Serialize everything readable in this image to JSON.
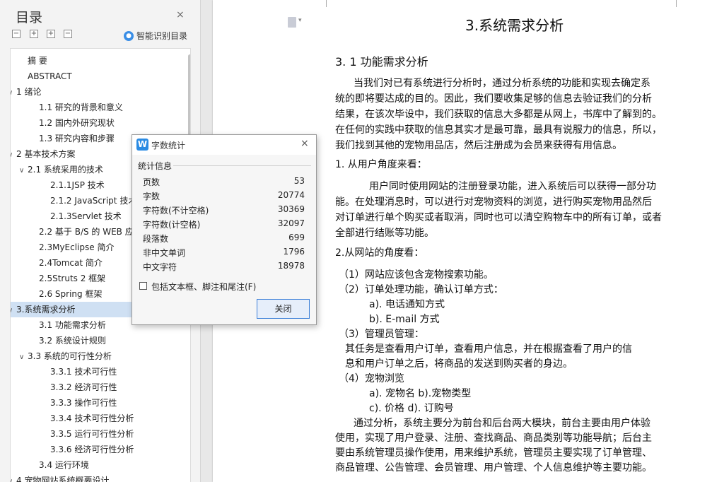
{
  "sidebar": {
    "title": "目录",
    "close_glyph": "×",
    "toolbar": {
      "collapse_all": "−",
      "expand_all": "+",
      "expand_level": "+",
      "collapse_level": "−"
    },
    "smart_toc_label": "智能识别目录",
    "items": [
      {
        "label": "摘  要",
        "chevron": ""
      },
      {
        "label": "ABSTRACT",
        "chevron": ""
      },
      {
        "label": "1 绪论",
        "chevron": "∨"
      },
      {
        "label": "1.1 研究的背景和意义",
        "chevron": ""
      },
      {
        "label": "1.2 国内外研究现状",
        "chevron": ""
      },
      {
        "label": "1.3 研究内容和步骤",
        "chevron": ""
      },
      {
        "label": "2 基本技术方案",
        "chevron": "∨"
      },
      {
        "label": "2.1 系统采用的技术",
        "chevron": "∨"
      },
      {
        "label": "2.1.1JSP 技术",
        "chevron": ""
      },
      {
        "label": "2.1.2 JavaScript 技术",
        "chevron": ""
      },
      {
        "label": "2.1.3Servlet 技术",
        "chevron": ""
      },
      {
        "label": "2.2 基于 B/S 的 WEB 应用",
        "chevron": ""
      },
      {
        "label": "2.3MyEclipse 简介",
        "chevron": ""
      },
      {
        "label": "2.4Tomcat 简介",
        "chevron": ""
      },
      {
        "label": "2.5Struts 2 框架",
        "chevron": ""
      },
      {
        "label": "2.6 Spring 框架",
        "chevron": ""
      },
      {
        "label": "3.系统需求分析",
        "chevron": "∨",
        "active": true
      },
      {
        "label": "3.1 功能需求分析",
        "chevron": ""
      },
      {
        "label": "3.2 系统设计规则",
        "chevron": ""
      },
      {
        "label": "3.3 系统的可行性分析",
        "chevron": "∨"
      },
      {
        "label": "3.3.1 技术可行性",
        "chevron": ""
      },
      {
        "label": "3.3.2 经济可行性",
        "chevron": ""
      },
      {
        "label": "3.3.3 操作可行性",
        "chevron": ""
      },
      {
        "label": "3.3.4  技术可行性分析",
        "chevron": ""
      },
      {
        "label": "3.3.5  运行可行性分析",
        "chevron": ""
      },
      {
        "label": "3.3.6  经济可行性分析",
        "chevron": ""
      },
      {
        "label": "3.4 运行环境",
        "chevron": ""
      },
      {
        "label": "4 宠物网站系统概要设计",
        "chevron": "∨"
      }
    ]
  },
  "document": {
    "chapter_title": "3.系统需求分析",
    "section_title": "3. 1 功能需求分析",
    "lines": [
      "当我们对已有系统进行分析时，通过分析系统的功能和实现去确定系",
      "统的即将要达成的目的。因此，我们要收集足够的信息去验证我们的分析",
      "结果，在该次毕设中，我们获取的信息大多都是从网上，书库中了解到的。",
      "在任何的实践中获取的信息其实才是最可靠，最具有说服力的信息，所以，",
      "我们找到其他的宠物用品店，然后注册成为会员来获得有用信息。",
      "1. 从用户角度来看：",
      "用户同时使用网站的注册登录功能，进入系统后可以获得一部分功",
      "能。在处理消息时，可以进行对宠物资料的浏览，进行购买宠物用品然后",
      "对订单进行单个购买或者取消，同时也可以清空购物车中的所有订单，或者",
      "全部进行结账等功能。",
      "2.从网站的角度看：",
      "（1）网站应该包含宠物搜索功能。",
      "（2）订单处理功能，确认订单方式：",
      "a). 电话通知方式",
      "b).  E-mail 方式",
      "（3）管理员管理：",
      "其任务是查看用户订单，查看用户信息，并在根据查看了用户的信",
      "息和用户订单之后，将商品的发送到购买者的身边。",
      "（4）宠物浏览",
      "a). 宠物名  b).宠物类型",
      "c). 价格  d). 订购号",
      "通过分析，系统主要分为前台和后台两大模块，前台主要由用户体验",
      "使用，实现了用户登录、注册、查找商品、商品类别等功能导航；后台主",
      "要由系统管理员操作使用，用来维护系统，管理员主要实现了订单管理、",
      "商品管理、公告管理、会员管理、用户管理、个人信息维护等主要功能。"
    ]
  },
  "dialog": {
    "app_icon_letter": "W",
    "title": "字数统计",
    "close_glyph": "×",
    "section_label": "统计信息",
    "stats": [
      {
        "label": "页数",
        "value": "53"
      },
      {
        "label": "字数",
        "value": "20774"
      },
      {
        "label": "字符数(不计空格)",
        "value": "30369"
      },
      {
        "label": "字符数(计空格)",
        "value": "32097"
      },
      {
        "label": "段落数",
        "value": "699"
      },
      {
        "label": "非中文单词",
        "value": "1796"
      },
      {
        "label": "中文字符",
        "value": "18978"
      }
    ],
    "checkbox_label": "包括文本框、脚注和尾注(F)",
    "checkbox_checked": false,
    "close_button": "关闭"
  },
  "colors": {
    "toc_active_bg": "#cfe0f3",
    "button_border": "#3b7fd8",
    "app_icon": "#2b8be3"
  }
}
